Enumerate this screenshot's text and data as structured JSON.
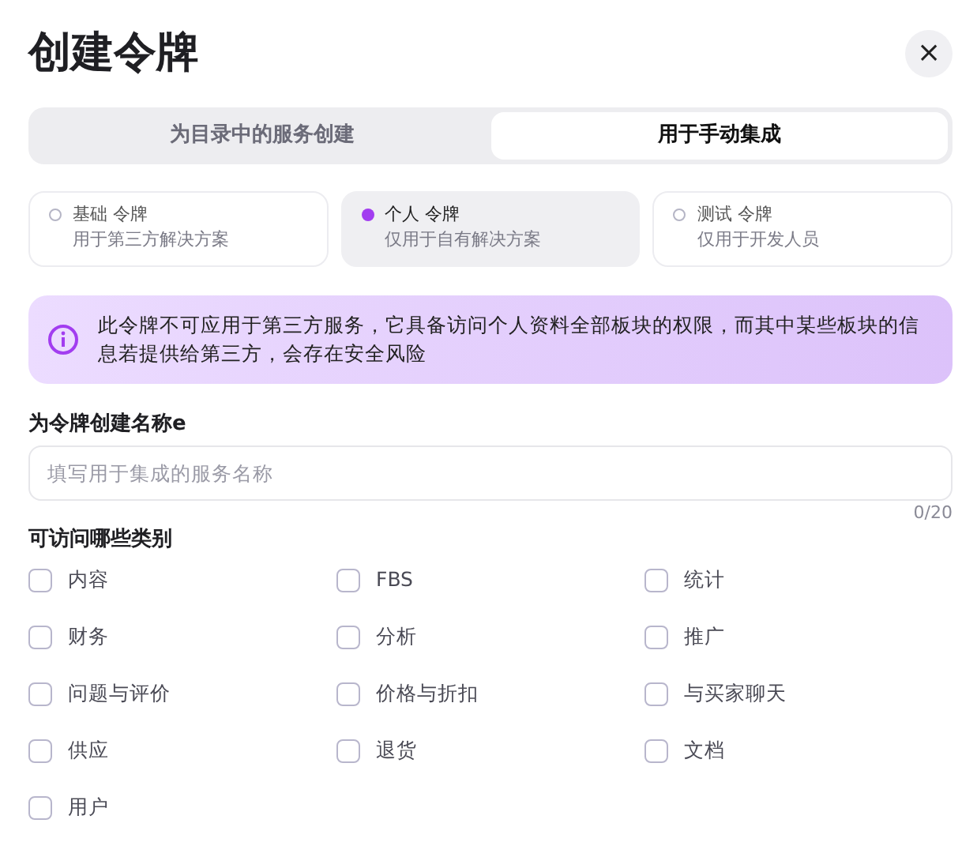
{
  "dialog": {
    "title": "创建令牌",
    "close": "×"
  },
  "tabs": [
    {
      "label": "为目录中的服务创建",
      "selected": false
    },
    {
      "label": "用于手动集成",
      "selected": true
    }
  ],
  "token_types": [
    {
      "title": "基础 令牌",
      "description": "用于第三方解决方案",
      "selected": false
    },
    {
      "title": "个人 令牌",
      "description": "仅用于自有解决方案",
      "selected": true
    },
    {
      "title": "测试 令牌",
      "description": "仅用于开发人员",
      "selected": false
    }
  ],
  "alert": {
    "text": "此令牌不可应用于第三方服务，它具备访问个人资料全部板块的权限，而其中某些板块的信息若提供给第三方，会存在安全风险"
  },
  "name_field": {
    "label": "为令牌创建名称e",
    "placeholder": "填写用于集成的服务名称",
    "counter": "0/20"
  },
  "categories": {
    "label": "可访问哪些类别",
    "items": [
      {
        "label": "内容",
        "checked": false
      },
      {
        "label": "FBS",
        "checked": false
      },
      {
        "label": "统计",
        "checked": false
      },
      {
        "label": "财务",
        "checked": false
      },
      {
        "label": "分析",
        "checked": false
      },
      {
        "label": "推广",
        "checked": false
      },
      {
        "label": "问题与评价",
        "checked": false
      },
      {
        "label": "价格与折扣",
        "checked": false
      },
      {
        "label": "与买家聊天",
        "checked": false
      },
      {
        "label": "供应",
        "checked": false
      },
      {
        "label": "退货",
        "checked": false
      },
      {
        "label": "文档",
        "checked": false
      },
      {
        "label": "用户",
        "checked": false
      }
    ]
  }
}
